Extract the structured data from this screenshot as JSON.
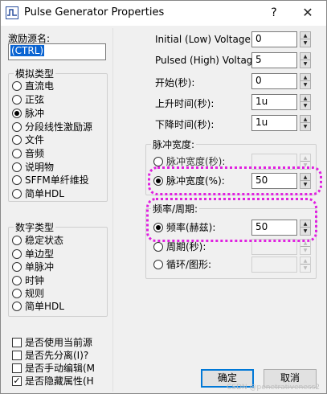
{
  "window": {
    "title": "Pulse Generator Properties",
    "help_label": "?",
    "close_label": "✕"
  },
  "left": {
    "name_label": "激励源名:",
    "name_value": "(CTRL)",
    "analog_group": {
      "title": "模拟类型",
      "options": [
        {
          "label": "直流电",
          "checked": false
        },
        {
          "label": "正弦",
          "checked": false
        },
        {
          "label": "脉冲",
          "checked": true
        },
        {
          "label": "分段线性激励源",
          "checked": false
        },
        {
          "label": "文件",
          "checked": false
        },
        {
          "label": "音频",
          "checked": false
        },
        {
          "label": "说明物",
          "checked": false
        },
        {
          "label": "SFFM单纤维投",
          "checked": false
        },
        {
          "label": "简单HDL",
          "checked": false
        }
      ]
    },
    "digital_group": {
      "title": "数字类型",
      "options": [
        {
          "label": "稳定状态",
          "checked": false
        },
        {
          "label": "单边型",
          "checked": false
        },
        {
          "label": "单脉冲",
          "checked": false
        },
        {
          "label": "时钟",
          "checked": false
        },
        {
          "label": "规则",
          "checked": false
        },
        {
          "label": "简单HDL",
          "checked": false
        }
      ]
    },
    "checkboxes": [
      {
        "label": "是否使用当前源",
        "checked": false
      },
      {
        "label": "是否先分离(I)?",
        "checked": false
      },
      {
        "label": "是否手动编辑(M",
        "checked": false
      },
      {
        "label": "是否隐藏属性(H",
        "checked": true
      }
    ]
  },
  "right": {
    "fields": [
      {
        "label": "Initial (Low) Voltage:",
        "value": "0"
      },
      {
        "label": "Pulsed (High) Voltage:",
        "value": "5"
      },
      {
        "label": "开始(秒):",
        "value": "0"
      },
      {
        "label": "上升时间(秒):",
        "value": "1u"
      },
      {
        "label": "下降时间(秒):",
        "value": "1u"
      }
    ],
    "width_group": {
      "title": "脉冲宽度:",
      "options": [
        {
          "label": "脉冲宽度(秒):",
          "checked": false,
          "value": "",
          "enabled": false
        },
        {
          "label": "脉冲宽度(%):",
          "checked": true,
          "value": "50",
          "enabled": true
        }
      ]
    },
    "freq_group": {
      "title": "频率/周期:",
      "options": [
        {
          "label": "频率(赫兹):",
          "checked": true,
          "value": "50",
          "enabled": true
        },
        {
          "label": "周期(秒):",
          "checked": false,
          "value": "",
          "enabled": false
        },
        {
          "label": "循环/图形:",
          "checked": false,
          "value": "",
          "enabled": false
        }
      ]
    },
    "ok_label": "确定",
    "cancel_label": "取消"
  },
  "watermark": "CSDN @penetrativeness2",
  "colors": {
    "highlight": "#e020e0",
    "selection": "#0a64d2",
    "default_button_border": "#0078d7"
  }
}
